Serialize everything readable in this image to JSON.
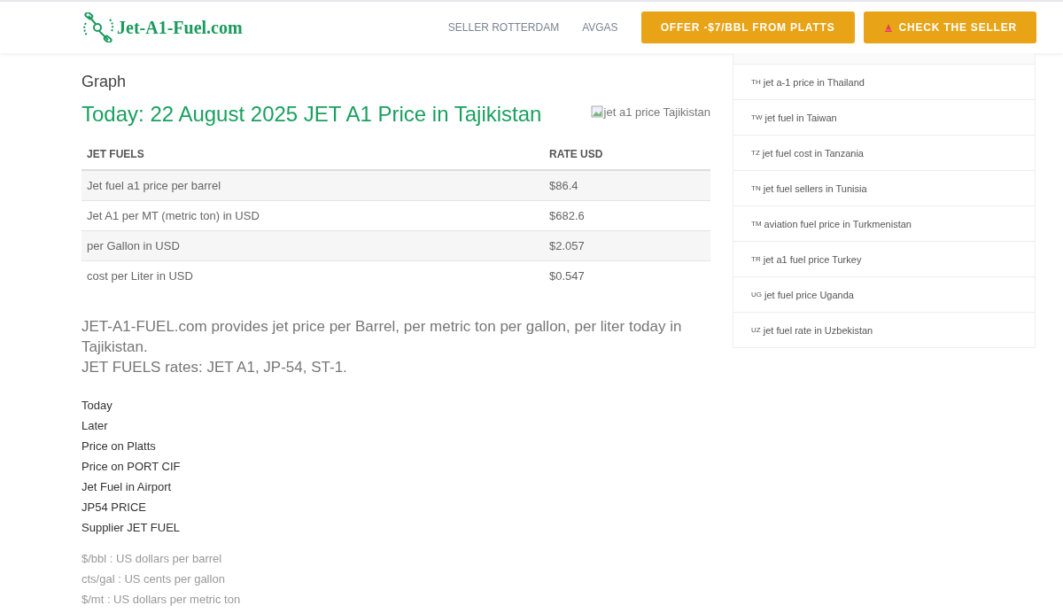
{
  "header": {
    "logo": "Jet-A1-Fuel.com",
    "nav": [
      "SELLER ROTTERDAM",
      "AVGAS"
    ],
    "buttons": [
      {
        "label": "OFFER -$7/BBL FROM PLATTS",
        "kind": "plain"
      },
      {
        "label": "CHECK THE SELLER",
        "kind": "icon"
      }
    ]
  },
  "subtitle": "Graph",
  "title": "Today: 22 August 2025 JET A1 Price in Tajikistan",
  "image_alt": "jet a1 price Tajikistan",
  "table": {
    "columns": [
      "JET FUELS",
      "RATE USD"
    ],
    "rows": [
      [
        "Jet fuel a1 price per barrel",
        "$86.4"
      ],
      [
        "Jet A1 per MT (metric ton) in USD",
        "$682.6"
      ],
      [
        "per Gallon in USD",
        "$2.057"
      ],
      [
        "cost per Liter in USD",
        "$0.547"
      ]
    ]
  },
  "paragraphs": [
    "JET-A1-FUEL.com provides jet price per Barrel, per metric ton per gallon, per liter today in Tajikistan.",
    "JET FUELS rates: JET A1, JP-54, ST-1."
  ],
  "links": [
    "Today",
    "Later",
    "Price on Platts",
    "Price on PORT CIF",
    "Jet Fuel in Airport",
    "JP54 PRICE",
    "Supplier JET FUEL"
  ],
  "notes": [
    "$/bbl : US dollars per barrel",
    "cts/gal : US cents per gallon",
    "$/mt : US dollars per metric ton"
  ],
  "sidebar": [
    {
      "code": "TH",
      "label": "jet a-1 price in Thailand"
    },
    {
      "code": "TW",
      "label": "jet fuel in Taiwan"
    },
    {
      "code": "TZ",
      "label": "jet fuel cost in Tanzania"
    },
    {
      "code": "TN",
      "label": "jet fuel sellers in Tunisia"
    },
    {
      "code": "TM",
      "label": "aviation fuel price in Turkmenistan"
    },
    {
      "code": "TR",
      "label": "jet a1 fuel price Turkey"
    },
    {
      "code": "UG",
      "label": "jet fuel price Uganda"
    },
    {
      "code": "UZ",
      "label": "jet fuel rate in Uzbekistan"
    }
  ]
}
